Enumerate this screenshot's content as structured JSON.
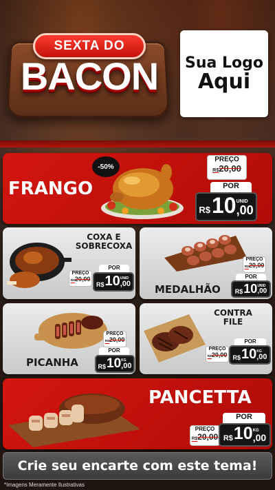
{
  "header": {
    "ribbon_text": "SEXTA DO",
    "title": "BACON",
    "logo_line1": "Sua Logo",
    "logo_line2": "Aqui"
  },
  "products": {
    "frango": {
      "name": "FRANGO",
      "discount": "-50%",
      "preco_label": "PREÇO",
      "old_currency": "R$",
      "old_price": "20,00",
      "por_label": "POR",
      "currency": "R$",
      "price_int": "10",
      "price_dec": ",00",
      "unit": "UNID"
    },
    "coxa": {
      "name_line1": "COXA E",
      "name_line2": "SOBRECOXA",
      "preco_label": "PREÇO",
      "old_currency": "R$",
      "old_price": "20,00",
      "por_label": "POR",
      "currency": "R$",
      "price_int": "10",
      "price_dec": ",00",
      "unit": "UNID"
    },
    "medalhao": {
      "name": "MEDALHÃO",
      "preco_label": "PREÇO",
      "old_currency": "R$",
      "old_price": "20,00",
      "por_label": "POR",
      "currency": "R$",
      "price_int": "10",
      "price_dec": ",00",
      "unit": "UNID"
    },
    "picanha": {
      "name": "PICANHA",
      "preco_label": "PREÇO",
      "old_currency": "R$",
      "old_price": "20,00",
      "por_label": "POR",
      "currency": "R$",
      "price_int": "10",
      "price_dec": ",00",
      "unit": "KG"
    },
    "contrafile": {
      "name_line1": "CONTRA",
      "name_line2": "FILE",
      "preco_label": "PREÇO",
      "old_currency": "R$",
      "old_price": "20,00",
      "por_label": "POR",
      "currency": "R$",
      "price_int": "10",
      "price_dec": ",00",
      "unit": "KG"
    },
    "pancetta": {
      "name": "PANCETTA",
      "preco_label": "PREÇO",
      "old_currency": "R$",
      "old_price": "20,00",
      "por_label": "POR",
      "currency": "R$",
      "price_int": "10",
      "price_dec": ",00",
      "unit": "KG"
    }
  },
  "footer": {
    "cta": "Crie seu encarte com este tema!",
    "note": "*Imagens Meramente Ilustrativas"
  },
  "colors": {
    "accent_red": "#d3150f",
    "card_grey": "#dedede",
    "price_box": "#151515"
  }
}
